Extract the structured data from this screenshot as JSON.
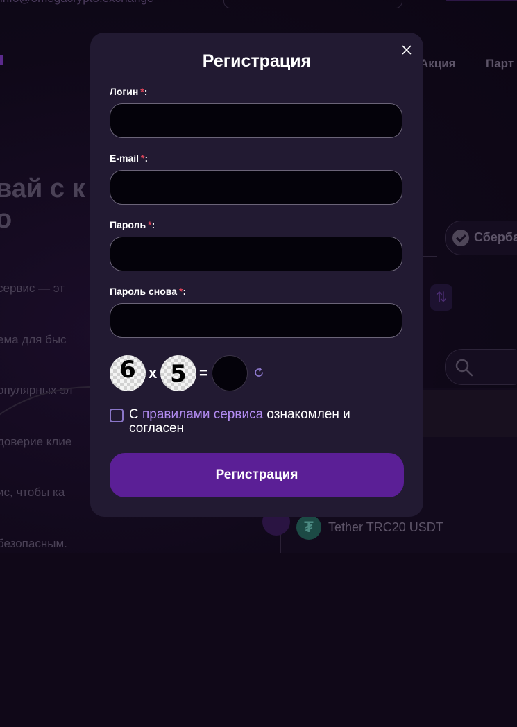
{
  "background": {
    "email": "info@omegacrypto.exchange",
    "nav": [
      "Акция",
      "Парт"
    ],
    "hero_lines": [
      "вай с к",
      "о"
    ],
    "paragraph": [
      "сервис — эт",
      "ема для быс",
      "опулярных эл",
      "доверие клие",
      "ис, чтобы ка",
      "безопасным."
    ],
    "bank_label": "Сберба",
    "currency_label": "Tether TRC20 USDT"
  },
  "modal": {
    "title": "Регистрация",
    "fields": [
      {
        "label": "Логин",
        "required_mark": "*",
        "suffix": ":",
        "value": "",
        "placeholder": ""
      },
      {
        "label": "E-mail",
        "required_mark": "*",
        "suffix": ":",
        "value": "",
        "placeholder": ""
      },
      {
        "label": "Пароль",
        "required_mark": "*",
        "suffix": ":",
        "value": "",
        "placeholder": ""
      },
      {
        "label": "Пароль снова",
        "required_mark": "*",
        "suffix": ":",
        "value": "",
        "placeholder": ""
      }
    ],
    "captcha": {
      "operand1": "6",
      "operator": "x",
      "operand2": "5",
      "equals": "=",
      "answer": ""
    },
    "agreement": {
      "prefix": "С ",
      "link": "правилами сервиса",
      "suffix": " ознакомлен и согласен",
      "checked": false
    },
    "submit_label": "Регистрация"
  },
  "colors": {
    "modal_bg": "#221a32",
    "accent": "#5b1f96",
    "link": "#b38cf2",
    "required": "#e0455a"
  },
  "icons": [
    "close-icon",
    "refresh-icon",
    "checkbox-icon",
    "search-icon",
    "tether-icon",
    "swap-icon",
    "sber-icon"
  ]
}
